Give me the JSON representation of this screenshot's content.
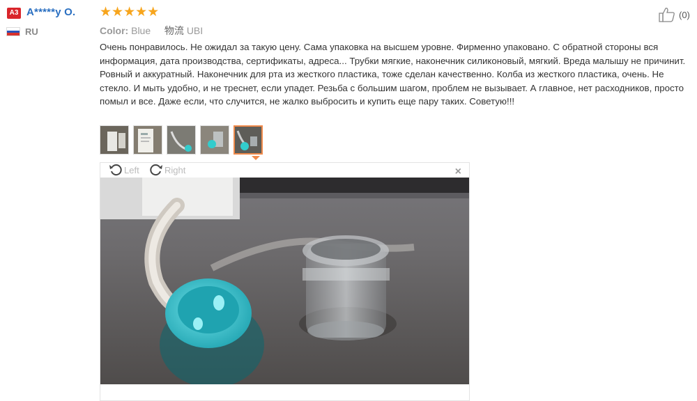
{
  "reviewer": {
    "avatar_initials": "A3",
    "name": "A*****y O.",
    "country_code": "RU",
    "flag_colors": [
      "#ffffff",
      "#2b53b8",
      "#d8312c"
    ]
  },
  "review": {
    "stars": "★★★★★",
    "rating": 5,
    "color_label": "Color:",
    "color_value": "Blue",
    "shipping_label": "物流",
    "shipping_value": "UBI",
    "text": "Очень понравилось. Не ожидал за такую цену. Сама упаковка на высшем уровне. Фирменно упаковано. С обратной стороны вся информация, дата производства, сертификаты, адреса... Трубки мягкие, наконечник силиконовый, мягкий. Вреда малышу не причинит. Ровный и аккуратный. Наконечник для рта из жесткого пластика, тоже сделан качественно. Колба из жесткого пластика, очень. Не стекло. И мыть удобно, и не треснет, если упадет. Резьба с большим шагом, проблем не вызывает. А главное, нет расходников, просто помыл и все. Даже если, что случится, не жалко выбросить и купить еще пару таких. Советую!!!",
    "like_count": "(0)"
  },
  "viewer": {
    "rotate_left_label": "Left",
    "rotate_right_label": "Right",
    "close_symbol": "×"
  },
  "colors": {
    "accent": "#f08a4b",
    "star": "#f7a51d",
    "username": "#2a6fc1",
    "avatar_bg": "#d9252b",
    "teal_cap": "#38c3cf"
  }
}
